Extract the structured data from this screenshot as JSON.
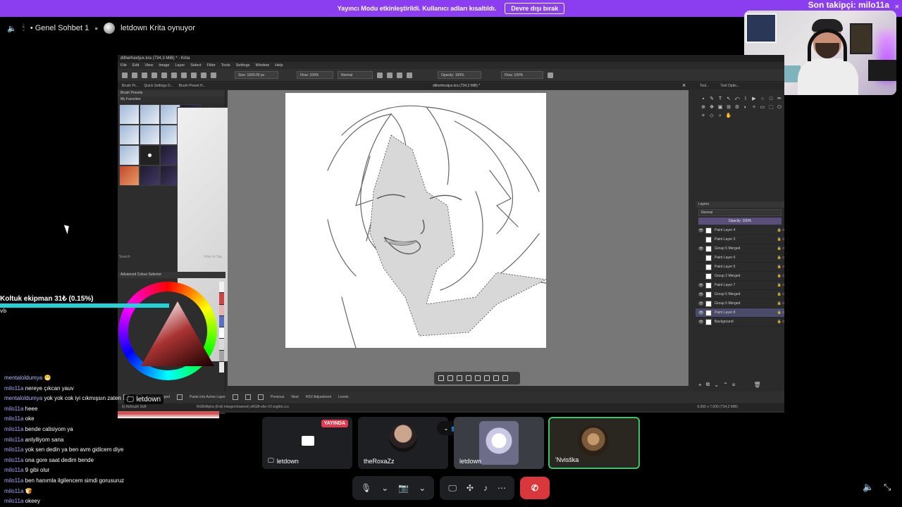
{
  "banner": {
    "message": "Yayıncı Modu etkinleştirildi. Kullanıcı adları kısaltıldı.",
    "button": "Devre dışı bırak",
    "close": "×"
  },
  "overlay": {
    "follower": "Son takipçi: milo11a",
    "donation": "Koltuk ekipman    31₺ (0.15%)",
    "donation_progress": 0.0015,
    "donation_sub": "vb",
    "stream_tag": "letdown"
  },
  "voice_header": {
    "channel": "• Genel Sohbet 1",
    "activity": "letdown Krita oynuyor"
  },
  "krita": {
    "title": "ditherhextjux.kra (734,3 MiB) * - Krita",
    "menu": [
      "File",
      "Edit",
      "View",
      "Image",
      "Layer",
      "Select",
      "Filter",
      "Tools",
      "Settings",
      "Window",
      "Help"
    ],
    "size_field": "Size: 1000.00 px",
    "flow_field": "Flow: 100%",
    "blend_field": "Normal",
    "opacity_field": "Opacity: 100%",
    "flow_field2": "Flow: 100%",
    "left_tabs": [
      "Brush Pr...",
      "Quick Settings D...",
      "Brush Preset H..."
    ],
    "doc_tab": "ditherhextjux.kra (734,3 MiB) *",
    "right_tabs": [
      "Tool...",
      "Tool Optio..."
    ],
    "brush_presets_title": "Brush Presets",
    "favorites": "My Favorites",
    "search": "Search",
    "filter_tag": "Filter in Tag",
    "color_selector_title": "Advanced Colour Selector",
    "color_label": "TRY",
    "layers_title": "Layers",
    "blend_mode": "Normal",
    "layer_opacity": "Opacity: 100%",
    "layers": [
      {
        "name": "Paint Layer 4",
        "visible": true,
        "selected": false
      },
      {
        "name": "Paint Layer 3",
        "visible": false,
        "selected": false
      },
      {
        "name": "Group 5 Merged",
        "visible": true,
        "selected": false
      },
      {
        "name": "Paint Layer 6",
        "visible": false,
        "selected": false
      },
      {
        "name": "Paint Layer 5",
        "visible": false,
        "selected": false
      },
      {
        "name": "Group 2 Merged",
        "visible": false,
        "selected": false
      },
      {
        "name": "Paint Layer 7",
        "visible": true,
        "selected": false
      },
      {
        "name": "Group 5 Merged",
        "visible": true,
        "selected": false
      },
      {
        "name": "Group 5 Merged",
        "visible": true,
        "selected": false
      },
      {
        "name": "Paint Layer 8",
        "visible": true,
        "selected": true
      },
      {
        "name": "Background",
        "visible": true,
        "selected": false
      }
    ],
    "bottom_bar": {
      "copy_merged": "Copy merged",
      "paste_active": "Paste into Active Layer",
      "previous": "Previous",
      "next": "Next",
      "hsv": "HSV Adjustment",
      "levels": "Levels"
    },
    "status_left": "RGB/Alpha (8-bit integer/channel)  sRGB-elle-V2-srgbtrc.icc",
    "status_right": "6,000 x 7,000 (734,3 MiB)",
    "status_zoom": "12.5%",
    "brush_name": "b) Airbrush Soft"
  },
  "chat": [
    {
      "user": "mentaloldumya",
      "text": "😁"
    },
    {
      "user": "milo11a",
      "text": "nereye çıkcan yauv"
    },
    {
      "user": "mentaloldumya",
      "text": "yok yok cok iyi cıkmışsın zaten"
    },
    {
      "user": "milo11a",
      "text": "heee"
    },
    {
      "user": "milo11a",
      "text": "oke"
    },
    {
      "user": "milo11a",
      "text": "bende calisiyom ya"
    },
    {
      "user": "milo11a",
      "text": "anlyiliyom sana"
    },
    {
      "user": "milo11a",
      "text": "yok sen dedin ya ben avm gidicem diye"
    },
    {
      "user": "milo11a",
      "text": "ona gore saat dedim bende"
    },
    {
      "user": "milo11a",
      "text": "9 gibi olur"
    },
    {
      "user": "milo11a",
      "text": "ben hanımla ilgilencem simdi gorusuruz"
    },
    {
      "user": "milo11a",
      "text": "🍞"
    },
    {
      "user": "milo11a",
      "text": "okeey"
    }
  ],
  "call": {
    "live_badge": "YAYINDA",
    "participants": [
      {
        "name": "letdown",
        "type": "stream"
      },
      {
        "name": "theRoxaZz",
        "type": "camera"
      },
      {
        "name": "letdown",
        "type": "avatar"
      },
      {
        "name": "'Nvisška",
        "type": "avatar"
      }
    ]
  },
  "colors": {
    "banner": "#8b3ef0",
    "end_call": "#da373c",
    "speaking": "#3bc26b",
    "donation_bar": "#1fd3d8"
  }
}
